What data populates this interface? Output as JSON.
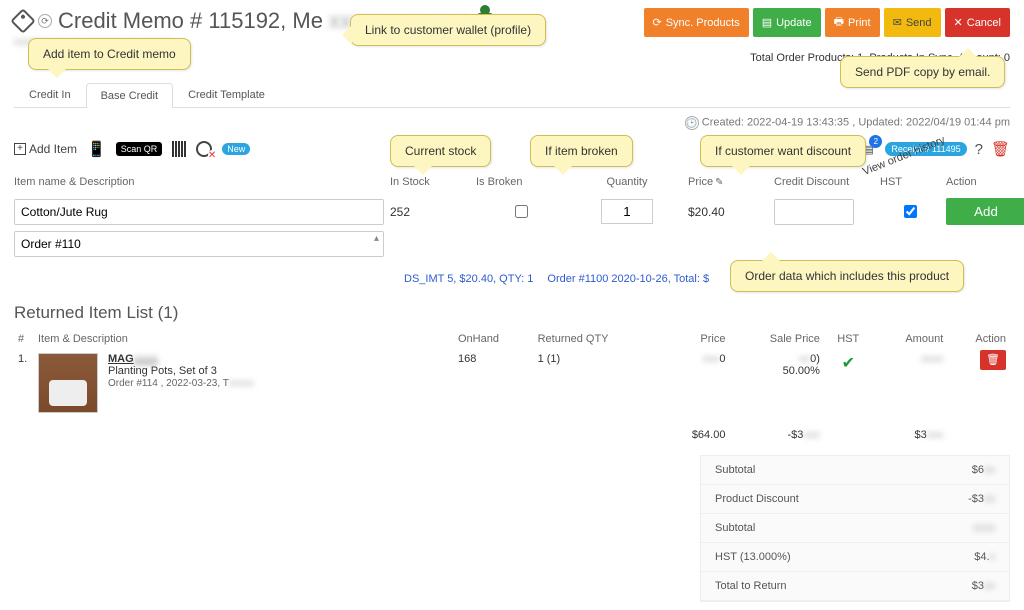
{
  "header": {
    "title": "Credit Memo # 115192, Me",
    "subtitle": "",
    "buttons": {
      "sync": "Sync. Products",
      "update": "Update",
      "print": "Print",
      "send": "Send",
      "cancel": "Cancel"
    },
    "totals_line": "Total Order Products: 1, Products In Sync. Account: 0",
    "meta": "Created: 2022-04-19 13:43:35 , Updated: 2022/04/19 01:44 pm"
  },
  "tabs": {
    "a": "Credit In",
    "b": "Base Credit",
    "c": "Credit Template"
  },
  "toolbar": {
    "add": "Add Item",
    "scanqr": "Scan QR",
    "new": "New",
    "receipt": "Receipt # 111495",
    "question": "?",
    "doc_count": "2"
  },
  "columns": {
    "name": "Item name & Description",
    "stock": "In Stock",
    "broken": "Is Broken",
    "qty": "Quantity",
    "price": "Price",
    "discount": "Credit Discount",
    "hst": "HST",
    "action": "Action"
  },
  "entry": {
    "item": "Cotton/Jute Rug",
    "order": "Order #110",
    "stock": "252",
    "qty": "1",
    "price": "$20.40",
    "add": "Add"
  },
  "orderline": {
    "a": "DS_IMT      5, $20.40, QTY: 1",
    "b": "Order #1100      2020-10-26, Total: $"
  },
  "list": {
    "title": "Returned Item List (1)",
    "cols": {
      "idx": "#",
      "desc": "Item & Description",
      "onhand": "OnHand",
      "rqty": "Returned QTY",
      "price": "Price",
      "sale": "Sale Price",
      "hst": "HST",
      "amount": "Amount",
      "action": "Action"
    },
    "row": {
      "idx": "1.",
      "name": "MAG",
      "sub": "Planting Pots, Set of 3",
      "ord": "Order #114      , 2022-03-23, T",
      "onhand": "168",
      "rqty": "1 (1)",
      "price": "0",
      "sale": "0)",
      "sale2": "50.00%",
      "amount": ""
    },
    "totals": {
      "price": "$64.00",
      "sale": "-$3",
      "amount": "$3"
    }
  },
  "summary": {
    "l1": "Subtotal",
    "v1": "$6",
    "l2": "Product Discount",
    "v2": "-$3",
    "l3": "Subtotal",
    "v3": "$",
    "l4": "HST (13.000%)",
    "v4": "$4.",
    "l5": "Total to Return",
    "v5": "$3"
  },
  "callouts": {
    "c1": "Add item to Credit memo",
    "c2": "Link to customer wallet (profile)",
    "c3": "Current stock",
    "c4": "If item broken",
    "c5": "If customer want discount",
    "c6": "Order data which includes this product",
    "c7": "Send PDF copy by email.",
    "diag": "View order history"
  }
}
